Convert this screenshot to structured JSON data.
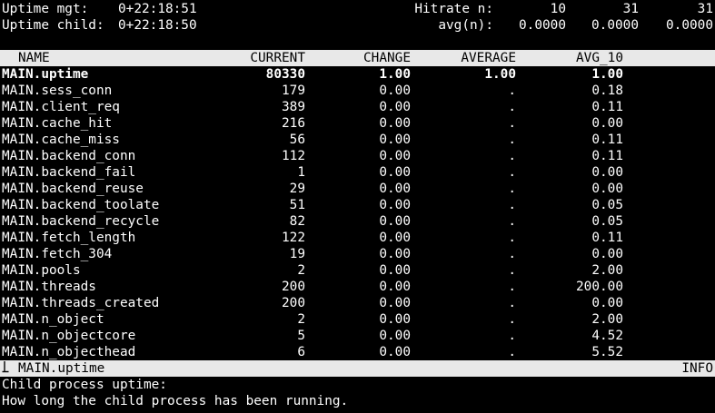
{
  "header": {
    "uptime_mgt_label": "Uptime mgt:",
    "uptime_mgt_value": "0+22:18:51",
    "uptime_child_label": "Uptime child:",
    "uptime_child_value": "0+22:18:50",
    "hitrate_label": "Hitrate n:",
    "hitrate_values": [
      "10",
      "31",
      "31"
    ],
    "avg_label": "avg(n):",
    "avg_values": [
      "0.0000",
      "0.0000",
      "0.0000"
    ]
  },
  "columns": [
    "NAME",
    "CURRENT",
    "CHANGE",
    "AVERAGE",
    "AVG_10"
  ],
  "rows": [
    {
      "name": "MAIN.uptime",
      "current": "80330",
      "change": "1.00",
      "average": "1.00",
      "avg10": "1.00"
    },
    {
      "name": "MAIN.sess_conn",
      "current": "179",
      "change": "0.00",
      "average": ".",
      "avg10": "0.18"
    },
    {
      "name": "MAIN.client_req",
      "current": "389",
      "change": "0.00",
      "average": ".",
      "avg10": "0.11"
    },
    {
      "name": "MAIN.cache_hit",
      "current": "216",
      "change": "0.00",
      "average": ".",
      "avg10": "0.00"
    },
    {
      "name": "MAIN.cache_miss",
      "current": "56",
      "change": "0.00",
      "average": ".",
      "avg10": "0.11"
    },
    {
      "name": "MAIN.backend_conn",
      "current": "112",
      "change": "0.00",
      "average": ".",
      "avg10": "0.11"
    },
    {
      "name": "MAIN.backend_fail",
      "current": "1",
      "change": "0.00",
      "average": ".",
      "avg10": "0.00"
    },
    {
      "name": "MAIN.backend_reuse",
      "current": "29",
      "change": "0.00",
      "average": ".",
      "avg10": "0.00"
    },
    {
      "name": "MAIN.backend_toolate",
      "current": "51",
      "change": "0.00",
      "average": ".",
      "avg10": "0.05"
    },
    {
      "name": "MAIN.backend_recycle",
      "current": "82",
      "change": "0.00",
      "average": ".",
      "avg10": "0.05"
    },
    {
      "name": "MAIN.fetch_length",
      "current": "122",
      "change": "0.00",
      "average": ".",
      "avg10": "0.11"
    },
    {
      "name": "MAIN.fetch_304",
      "current": "19",
      "change": "0.00",
      "average": ".",
      "avg10": "0.00"
    },
    {
      "name": "MAIN.pools",
      "current": "2",
      "change": "0.00",
      "average": ".",
      "avg10": "2.00"
    },
    {
      "name": "MAIN.threads",
      "current": "200",
      "change": "0.00",
      "average": ".",
      "avg10": "200.00"
    },
    {
      "name": "MAIN.threads_created",
      "current": "200",
      "change": "0.00",
      "average": ".",
      "avg10": "0.00"
    },
    {
      "name": "MAIN.n_object",
      "current": "2",
      "change": "0.00",
      "average": ".",
      "avg10": "2.00"
    },
    {
      "name": "MAIN.n_objectcore",
      "current": "5",
      "change": "0.00",
      "average": ".",
      "avg10": "4.52"
    },
    {
      "name": "MAIN.n_objecthead",
      "current": "6",
      "change": "0.00",
      "average": ".",
      "avg10": "5.52"
    }
  ],
  "status_bar": {
    "selected_name": "MAIN.uptime",
    "verbosity": "INFO"
  },
  "description": {
    "title": "Child process uptime:",
    "text": "How long the child process has been running."
  },
  "colors": {
    "background": "#000000",
    "foreground": "#ffffff",
    "bar_background": "#e8e8e8",
    "bar_foreground": "#000000"
  }
}
